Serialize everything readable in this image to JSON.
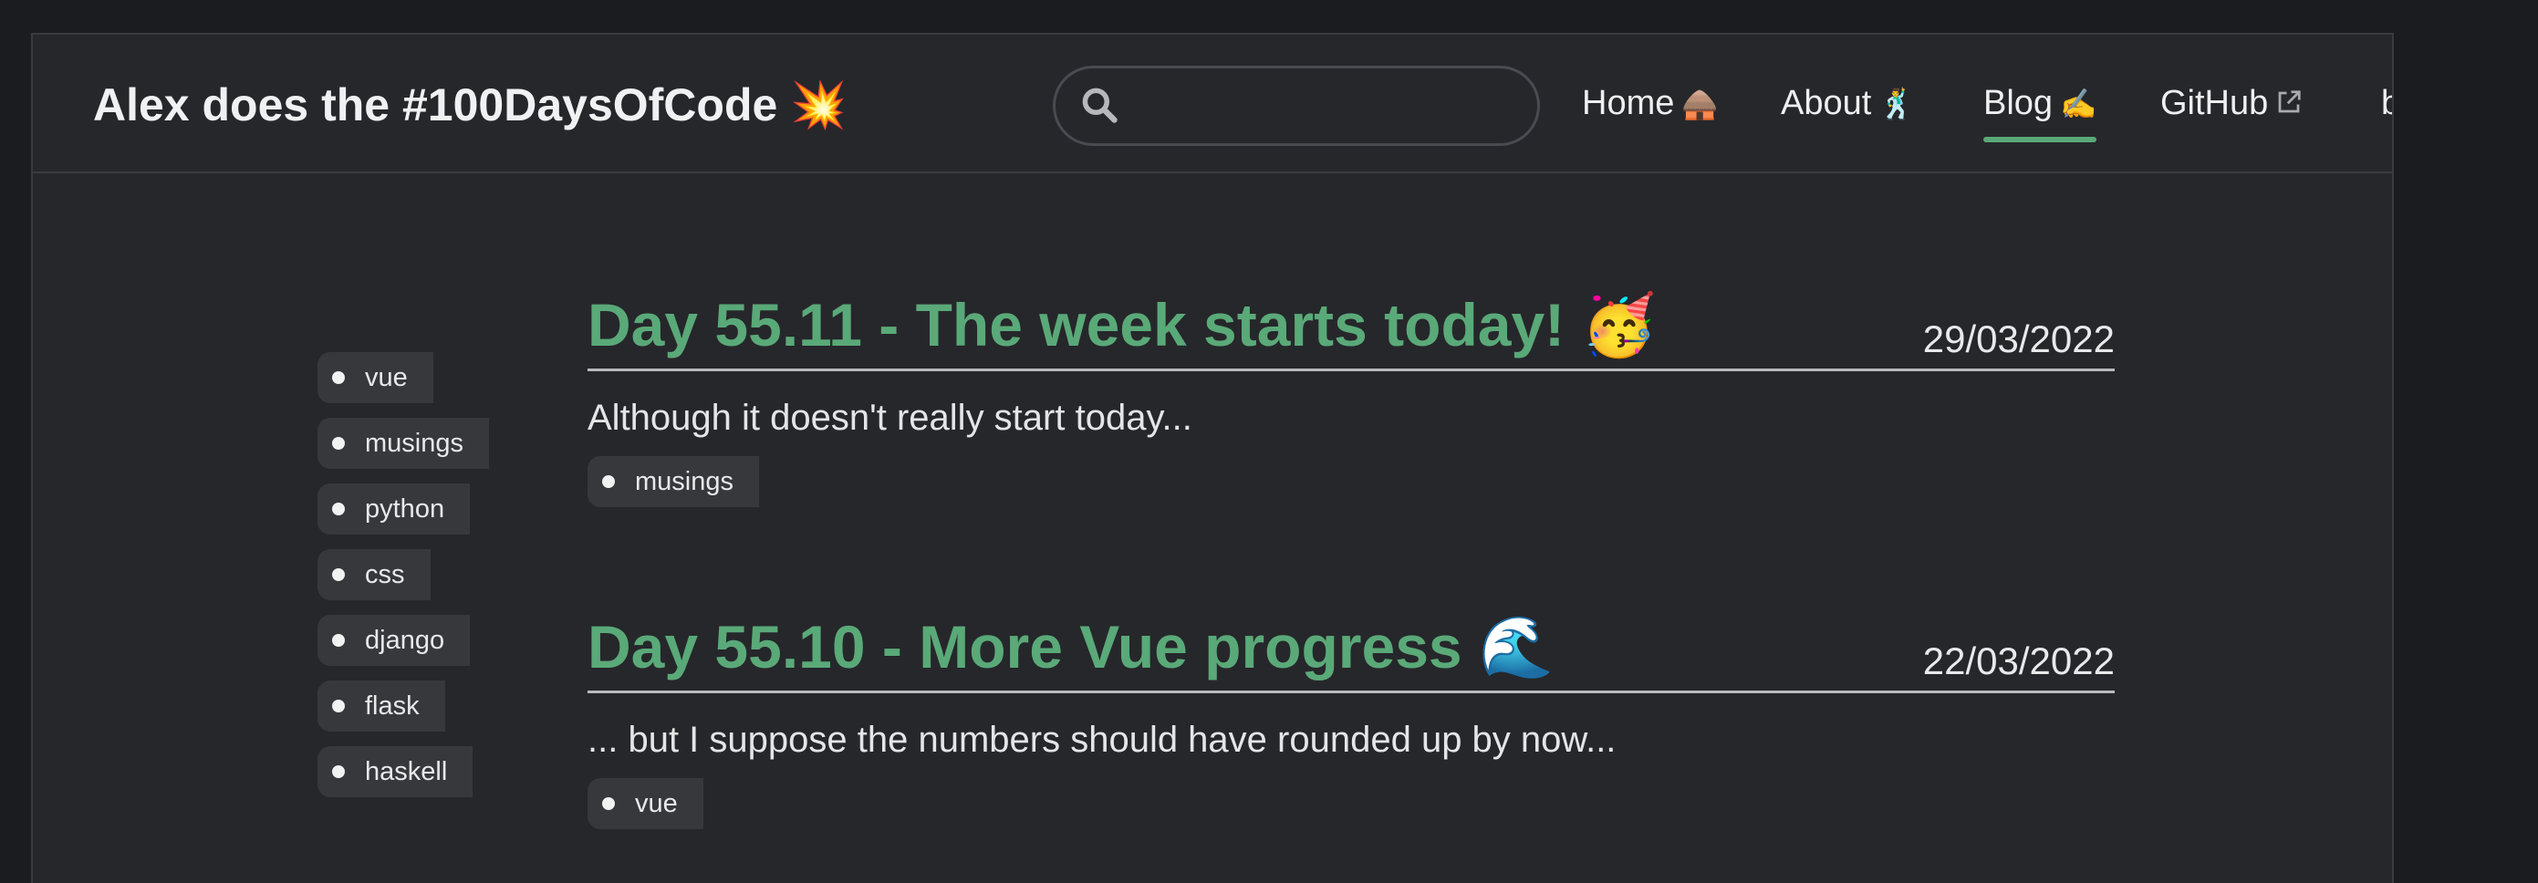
{
  "header": {
    "site_title": "Alex does the #100DaysOfCode 💥",
    "search": {
      "placeholder": "",
      "value": ""
    },
    "nav": [
      {
        "label": "Home",
        "emoji": "🛖"
      },
      {
        "label": "About",
        "emoji": "🕺"
      },
      {
        "label": "Blog",
        "emoji": "✍️",
        "active": true
      },
      {
        "label": "GitHub"
      },
      {
        "label": "b"
      }
    ]
  },
  "sidebar": {
    "tags": [
      "vue",
      "musings",
      "python",
      "css",
      "django",
      "flask",
      "haskell"
    ]
  },
  "posts": [
    {
      "title": "Day 55.11 - The week starts today! 🥳",
      "date": "29/03/2022",
      "summary": "Although it doesn't really start today...",
      "tags": [
        "musings"
      ]
    },
    {
      "title": "Day 55.10 - More Vue progress 🌊",
      "date": "22/03/2022",
      "summary": "... but I suppose the numbers should have rounded up by now...",
      "tags": [
        "vue"
      ]
    }
  ],
  "colors": {
    "accent": "#5aa978",
    "background": "#26272b",
    "outer_background": "#1b1c1f",
    "tag_background": "#37383c"
  }
}
